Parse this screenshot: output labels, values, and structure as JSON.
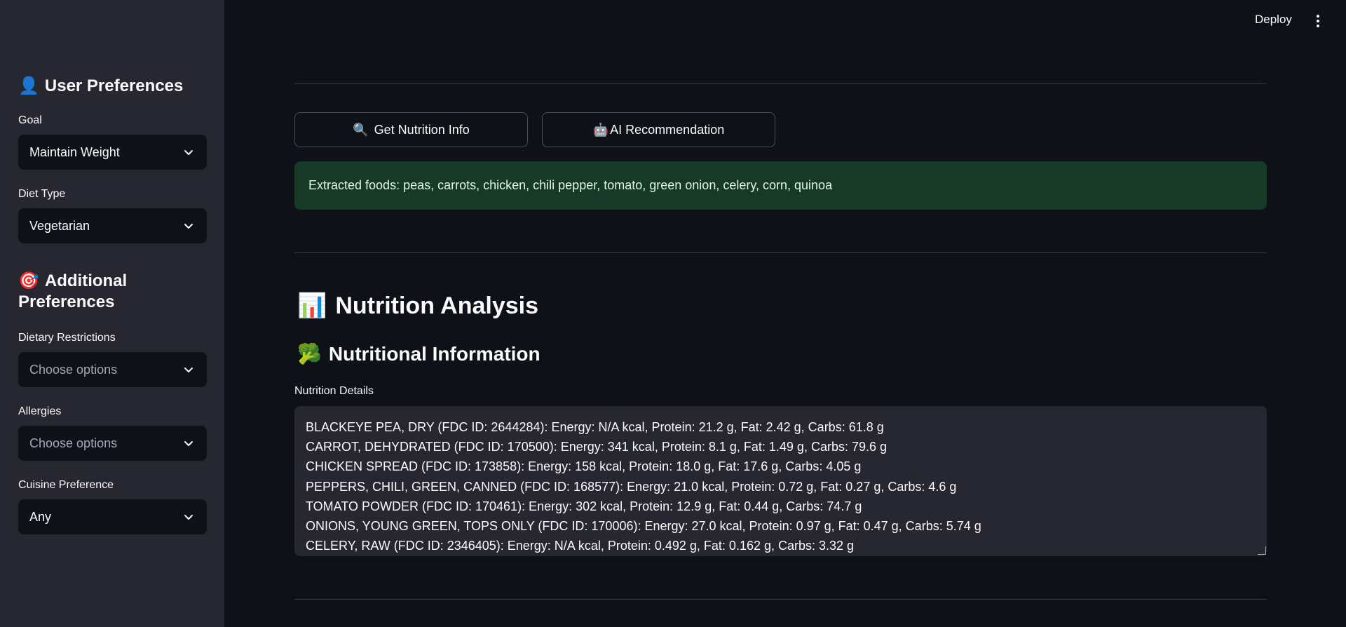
{
  "header": {
    "deploy_label": "Deploy"
  },
  "sidebar": {
    "user_prefs": {
      "emoji": "👤",
      "title": "User Preferences"
    },
    "goal": {
      "label": "Goal",
      "value": "Maintain Weight"
    },
    "diet_type": {
      "label": "Diet Type",
      "value": "Vegetarian"
    },
    "additional_prefs": {
      "emoji": "🎯",
      "title": "Additional Preferences"
    },
    "dietary_restrictions": {
      "label": "Dietary Restrictions",
      "placeholder": "Choose options"
    },
    "allergies": {
      "label": "Allergies",
      "placeholder": "Choose options"
    },
    "cuisine": {
      "label": "Cuisine Preference",
      "value": "Any"
    }
  },
  "main": {
    "buttons": {
      "nutrition": {
        "emoji": "🔍",
        "label": "Get Nutrition Info"
      },
      "ai": {
        "emoji": "🤖",
        "label": "AI Recommendation"
      }
    },
    "alert_text": "Extracted foods: peas, carrots, chicken, chili pepper, tomato, green onion, celery, corn, quinoa",
    "analysis": {
      "emoji": "📊",
      "title": "Nutrition Analysis"
    },
    "info": {
      "emoji": "🥦",
      "title": "Nutritional Information"
    },
    "details_label": "Nutrition Details",
    "details_lines": [
      "BLACKEYE PEA, DRY (FDC ID: 2644284): Energy: N/A kcal, Protein: 21.2 g, Fat: 2.42 g, Carbs: 61.8 g",
      "CARROT, DEHYDRATED (FDC ID: 170500): Energy: 341 kcal, Protein: 8.1 g, Fat: 1.49 g, Carbs: 79.6 g",
      "CHICKEN SPREAD (FDC ID: 173858): Energy: 158 kcal, Protein: 18.0 g, Fat: 17.6 g, Carbs: 4.05 g",
      "PEPPERS, CHILI, GREEN, CANNED (FDC ID: 168577): Energy: 21.0 kcal, Protein: 0.72 g, Fat: 0.27 g, Carbs: 4.6 g",
      "TOMATO POWDER (FDC ID: 170461): Energy: 302 kcal, Protein: 12.9 g, Fat: 0.44 g, Carbs: 74.7 g",
      "ONIONS, YOUNG GREEN, TOPS ONLY (FDC ID: 170006): Energy: 27.0 kcal, Protein: 0.97 g, Fat: 0.47 g, Carbs: 5.74 g",
      "CELERY, RAW (FDC ID: 2346405): Energy: N/A kcal, Protein: 0.492 g, Fat: 0.162 g, Carbs: 3.32 g"
    ]
  },
  "colors": {
    "sidebar_bg": "#262730",
    "main_bg": "#0e1117",
    "success_bg": "#173928"
  }
}
